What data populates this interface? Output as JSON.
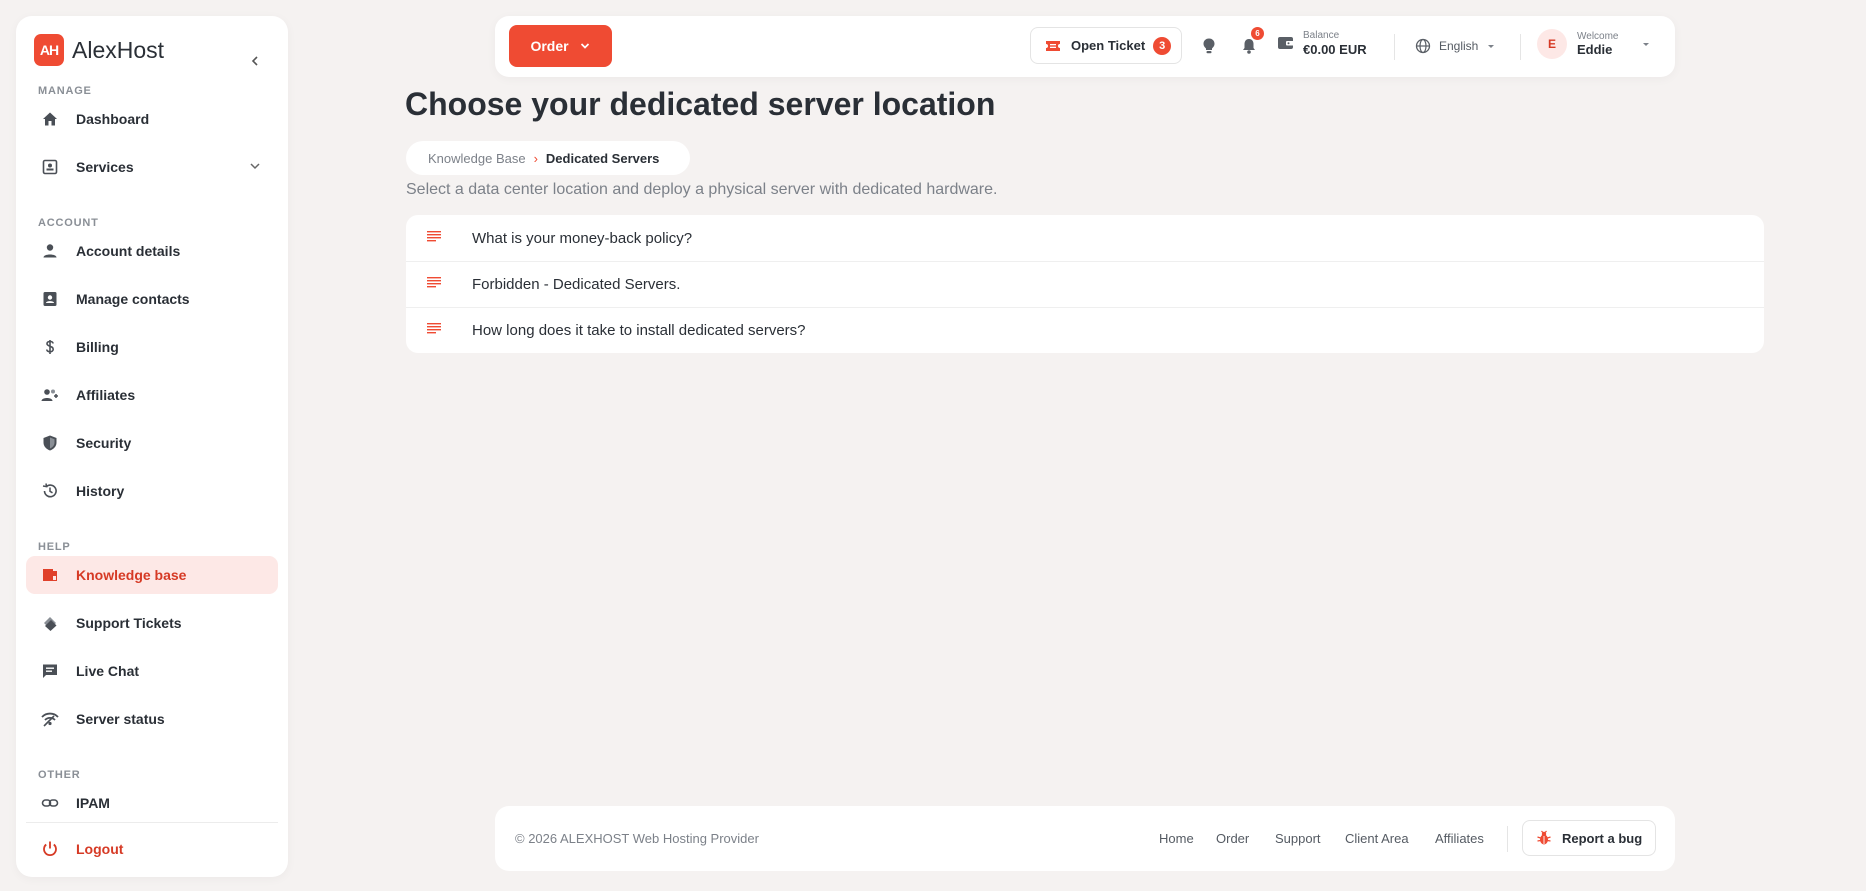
{
  "brand": {
    "logo_text": "AH",
    "name": "AlexHost"
  },
  "sidebar": {
    "sections": {
      "manage": "MANAGE",
      "account": "ACCOUNT",
      "help": "HELP",
      "other": "OTHER"
    },
    "items": [
      {
        "label": "Dashboard",
        "icon": "home-icon"
      },
      {
        "label": "Services",
        "icon": "services-icon"
      },
      {
        "label": "Account details",
        "icon": "person-icon"
      },
      {
        "label": "Manage contacts",
        "icon": "contacts-icon"
      },
      {
        "label": "Billing",
        "icon": "dollar-icon"
      },
      {
        "label": "Affiliates",
        "icon": "affiliates-icon"
      },
      {
        "label": "Security",
        "icon": "shield-icon"
      },
      {
        "label": "History",
        "icon": "history-icon"
      },
      {
        "label": "Knowledge base",
        "icon": "knowledge-base-icon",
        "active": true
      },
      {
        "label": "Support Tickets",
        "icon": "tickets-icon"
      },
      {
        "label": "Live Chat",
        "icon": "chat-icon"
      },
      {
        "label": "Server status",
        "icon": "signal-icon"
      },
      {
        "label": "IPAM",
        "icon": "link-icon"
      },
      {
        "label": "Logout",
        "icon": "power-icon"
      }
    ]
  },
  "topbar": {
    "order_label": "Order",
    "ticket_label": "Open Ticket",
    "ticket_count": "3",
    "notification_count": "6",
    "balance_caption": "Balance",
    "balance_value": "€0.00 EUR",
    "language": "English",
    "welcome_caption": "Welcome",
    "user_initial": "E",
    "user_name": "Eddie"
  },
  "main": {
    "title": "Choose your dedicated server location",
    "breadcrumb": [
      "Knowledge Base",
      "Dedicated Servers"
    ],
    "breadcrumb_separator": "›",
    "subtitle": "Select a data center location and deploy a physical server with dedicated hardware.",
    "articles": [
      "What is your money-back policy?",
      "Forbidden - Dedicated Servers.",
      "How long does it take to install dedicated servers?"
    ]
  },
  "footer": {
    "copyright": "© 2026 ALEXHOST Web Hosting Provider",
    "links": [
      "Home",
      "Order",
      "Support",
      "Client Area",
      "Affiliates"
    ],
    "bug_label": "Report a bug"
  },
  "colors": {
    "accent": "#ef4b33",
    "accent_soft": "#fde8e6",
    "background": "#f5f2f1",
    "text": "#2a2f36",
    "muted": "#7c8189"
  }
}
